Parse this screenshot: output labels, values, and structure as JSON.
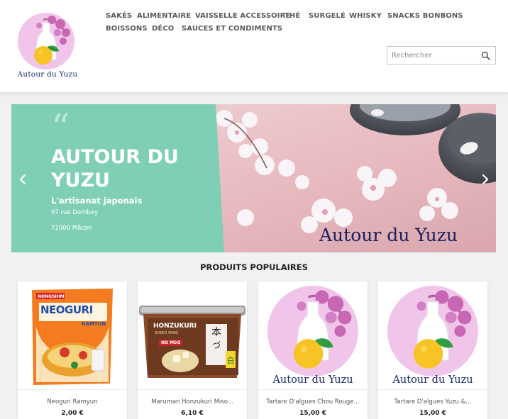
{
  "site": {
    "logo_text": "Autour du Yuzu"
  },
  "nav": {
    "items": [
      {
        "label": "SAKÉS"
      },
      {
        "label": "ALIMENTAIRE"
      },
      {
        "label": "VAISSELLE ACCESSOIRE"
      },
      {
        "label": "THÉ"
      },
      {
        "label": "SURGELÉ"
      },
      {
        "label": "WHISKY"
      },
      {
        "label": "SNACKS BONBONS"
      },
      {
        "label": "BOISSONS"
      },
      {
        "label": "DÉCO"
      },
      {
        "label": "SAUCES ET CONDIMENTS"
      }
    ]
  },
  "search": {
    "placeholder": "Rechercher",
    "icon": "search-icon"
  },
  "slider": {
    "quote": "“",
    "title": "AUTOUR DU YUZU",
    "subtitle": "L'artisanat japonais",
    "address_line1": "97 rue Dombey",
    "address_line2": "71000 Mâcon",
    "brand_text": "Autour du Yuzu",
    "panel_color": "#7fcfb7",
    "prev_icon": "chevron-left-icon",
    "next_icon": "chevron-right-icon"
  },
  "products": {
    "title": "PRODUITS POPULAIRES",
    "items": [
      {
        "name": "Neoguri Ramyun",
        "price": "2,00 €",
        "image": "neoguri-package",
        "pack_label": "NEOGURI",
        "pack_sub": "RAMYUN",
        "pack_brand": "NONGSHIM"
      },
      {
        "name": "Maruman Honzukuri Miso...",
        "price": "6,10 €",
        "image": "miso-tub",
        "tub_label": "HONZUKURI",
        "tub_sub": "SHIRO MISO",
        "tub_badge": "NO MSG"
      },
      {
        "name": "Tartare D'algues Chou Rouge...",
        "price": "15,00 €",
        "image": "brand-logo",
        "brand_text": "Autour du Yuzu"
      },
      {
        "name": "Tartare D'algues Yuzu &...",
        "price": "15,00 €",
        "image": "brand-logo",
        "brand_text": "Autour du Yuzu"
      }
    ]
  },
  "colors": {
    "accent_mint": "#7fcfb7",
    "logo_pink": "#f1c4ea",
    "brand_navy": "#1a2a6b",
    "nav_text": "#5b5b5b"
  }
}
